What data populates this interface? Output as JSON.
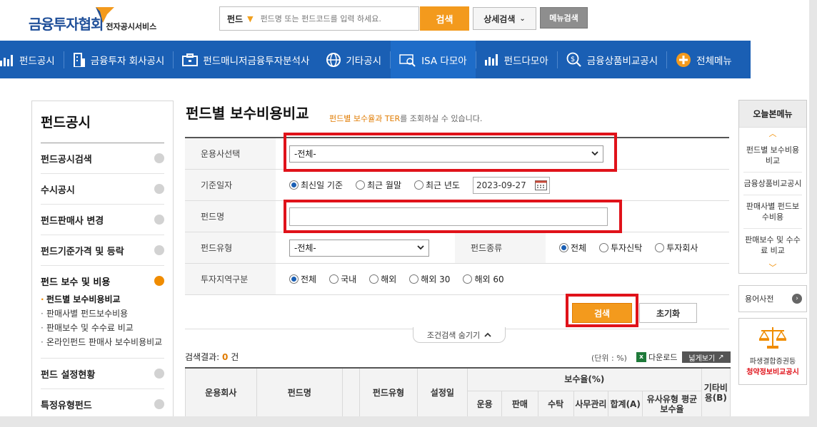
{
  "header": {
    "logo_main": "금융투자협회",
    "logo_sub": "전자공시서비스",
    "search_category": "펀드",
    "search_placeholder": "펀드명 또는 펀드코드를 입력 하세요.",
    "search_button": "검색",
    "detail_search": "상세검색",
    "menu_search": "메뉴검색"
  },
  "nav": {
    "items": [
      {
        "label": "펀드공시",
        "icon": "bar-chart-icon"
      },
      {
        "label": "금융투자 회사공시",
        "icon": "building-icon"
      },
      {
        "label": "펀드매니저금융투자분석사",
        "icon": "briefcase-icon"
      },
      {
        "label": "기타공시",
        "icon": "globe-icon"
      },
      {
        "label": "ISA 다모아",
        "icon": "isa-search-icon"
      },
      {
        "label": "펀드다모아",
        "icon": "bar-chart-icon"
      },
      {
        "label": "금융상품비교공시",
        "icon": "dollar-search-icon"
      },
      {
        "label": "전체메뉴",
        "icon": "plus-circle-icon"
      }
    ]
  },
  "sidebar": {
    "title": "펀드공시",
    "items": [
      {
        "label": "펀드공시검색"
      },
      {
        "label": "수시공시"
      },
      {
        "label": "펀드판매사 변경"
      },
      {
        "label": "펀드기준가격 및 등락"
      },
      {
        "label": "펀드 보수 및 비용"
      },
      {
        "label": "펀드 설정현황"
      },
      {
        "label": "특정유형펀드"
      }
    ],
    "sub_items": [
      "펀드별 보수비용비교",
      "판매사별 펀드보수비용",
      "판매보수 및 수수료 비교",
      "온라인펀드 판매사 보수비용비교"
    ]
  },
  "content": {
    "title": "펀드별 보수비용비교",
    "desc_em": "펀드별 보수율과 TER",
    "desc_rest": "를 조회하실 수 있습니다."
  },
  "form": {
    "company_label": "운용사선택",
    "company_value": "-전체-",
    "date_label": "기준일자",
    "date_options": [
      "최신일 기준",
      "최근 월말",
      "최근 년도"
    ],
    "date_value": "2023-09-27",
    "fund_name_label": "펀드명",
    "fund_name_value": "",
    "fund_type_label": "펀드유형",
    "fund_type_value": "-전체-",
    "fund_kind_label": "펀드종류",
    "fund_kind_options": [
      "전체",
      "투자신탁",
      "투자회사"
    ],
    "region_label": "투자지역구분",
    "region_options": [
      "전체",
      "국내",
      "해외",
      "해외 30",
      "해외 60"
    ],
    "search_button": "검색",
    "reset_button": "초기화",
    "toggle_label": "조건검색 숨기기"
  },
  "results": {
    "label": "검색결과:",
    "count": "0",
    "unit_suffix": "건",
    "unit_note": "(단위 : %)",
    "download": "다운로드",
    "wide_view": "넓게보기"
  },
  "table": {
    "col_company": "운용회사",
    "col_fund_name": "펀드명",
    "col_fund_type": "펀드유형",
    "col_setup_date": "설정일",
    "group_fee": "보수율(%)",
    "fee_cols": [
      "운용",
      "판매",
      "수탁",
      "사무관리",
      "합계(A)",
      "유사유형 평균보수율"
    ],
    "col_other": "기타비용(B)"
  },
  "right": {
    "today_title": "오늘본메뉴",
    "today_items": [
      "펀드별 보수비용비교",
      "금융상품비교공시",
      "판매사별 펀드보수비용",
      "판매보수 및 수수료 비교"
    ],
    "dict": "용어사전",
    "banner_line1": "파생결합증권등",
    "banner_line2": "청약정보비교공시"
  }
}
